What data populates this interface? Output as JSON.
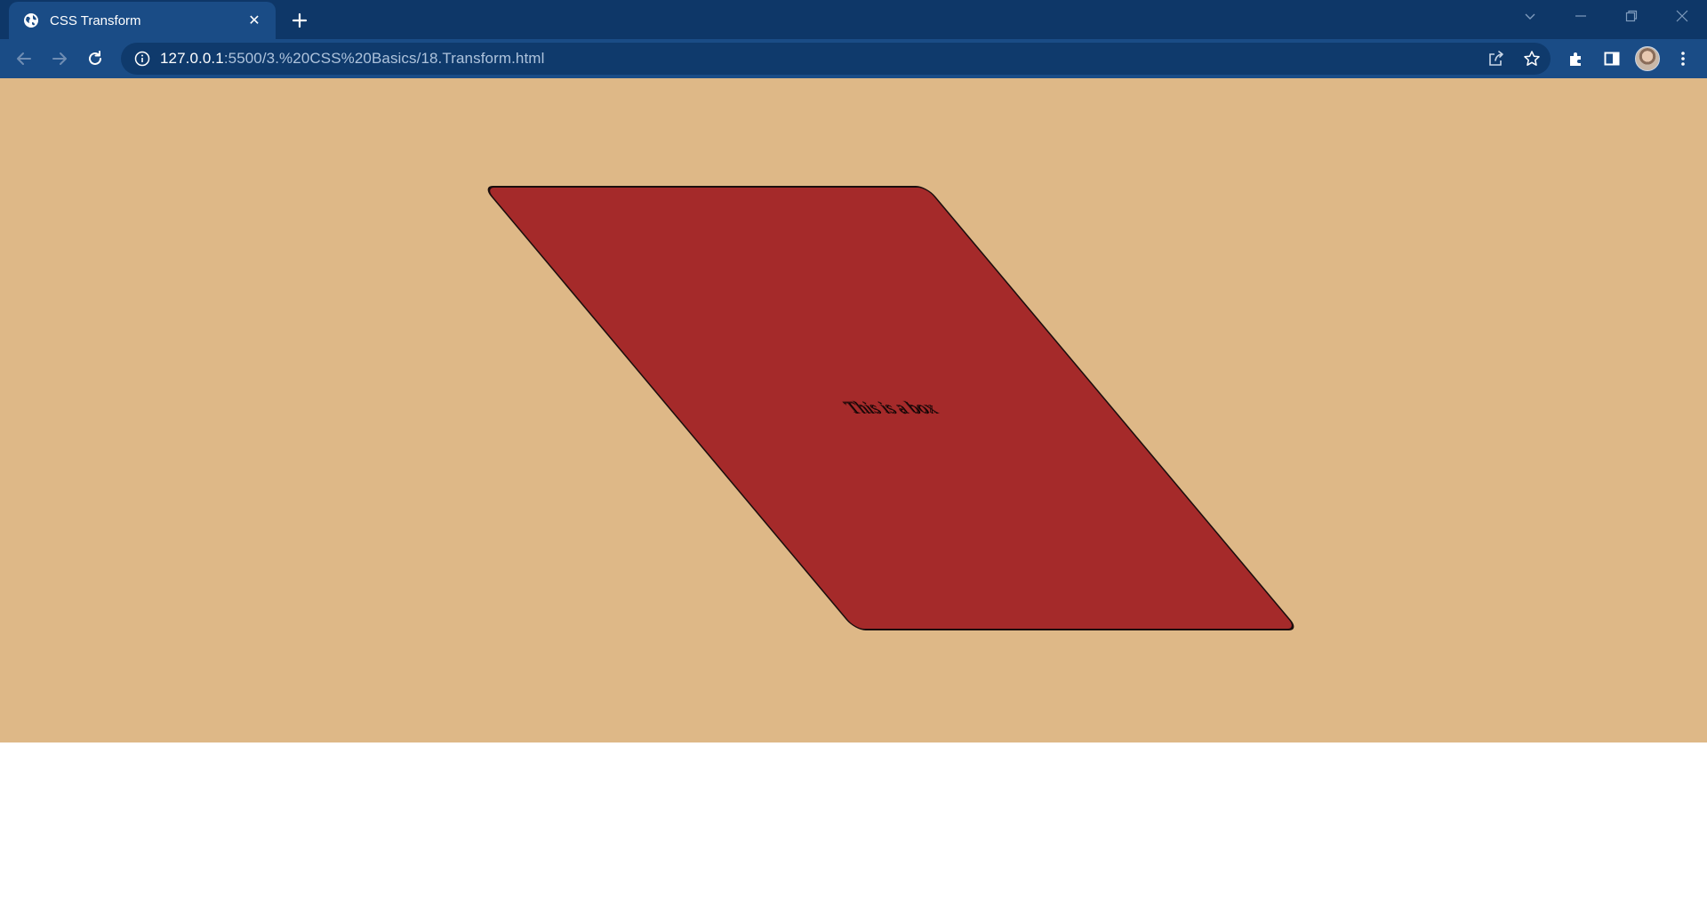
{
  "browser": {
    "tab": {
      "title": "CSS Transform",
      "close_label": "✕",
      "new_tab_label": "+"
    },
    "address_bar": {
      "host": "127.0.0.1",
      "path": ":5500/3.%20CSS%20Basics/18.Transform.html"
    },
    "colors": {
      "tabstrip": "#0e3768",
      "toolbar": "#1a4c86",
      "omnibox": "#0f3a6c"
    }
  },
  "page": {
    "background_color": "#deb887",
    "box": {
      "text": "This is a box",
      "color": "#a52a2a"
    }
  },
  "icons": {
    "favicon": "globe-icon",
    "back": "arrow-left-icon",
    "forward": "arrow-right-icon",
    "reload": "reload-icon",
    "info": "info-icon",
    "share": "share-icon",
    "bookmark": "star-icon",
    "extensions": "puzzle-icon",
    "side_panel": "side-panel-icon",
    "menu": "kebab-menu-icon"
  }
}
